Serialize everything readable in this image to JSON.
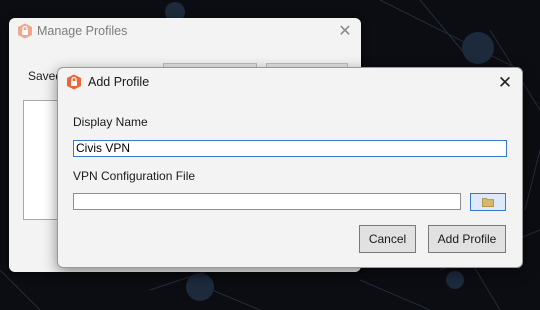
{
  "background_window": {
    "title": "Manage Profiles",
    "saved_label": "Saved",
    "close_glyph": "✕"
  },
  "dialog": {
    "title": "Add Profile",
    "close_glyph": "✕",
    "display_name_label": "Display Name",
    "display_name_value": "Civis VPN",
    "vpn_config_label": "VPN Configuration File",
    "vpn_config_value": "",
    "browse_icon": "folder-icon",
    "cancel_label": "Cancel",
    "add_label": "Add Profile"
  },
  "colors": {
    "app_icon": "#e8683a",
    "accent_border": "#3a78c9",
    "background": "#0b0d12"
  }
}
